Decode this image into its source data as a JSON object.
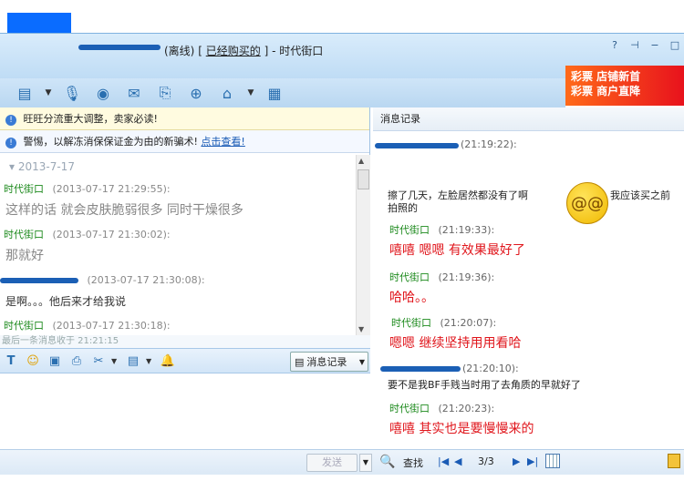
{
  "titlebar": {
    "status": "(离线)",
    "bracket_open": "[",
    "purchase_link": "已经购买的",
    "bracket_close": "]",
    "separator": "-",
    "shop_name": "时代街口"
  },
  "title_buttons": [
    "?",
    "⊣",
    "−",
    "□"
  ],
  "ad": {
    "line1": "彩票  店铺新首",
    "line2": "彩票  商户直降"
  },
  "toolbar_icons": [
    "send-file-icon",
    "microphone-icon",
    "camera-icon",
    "message-icon",
    "mail-icon",
    "share-icon",
    "shop-icon",
    "document-icon"
  ],
  "notices": [
    {
      "text": "旺旺分流重大调整，卖家必读!",
      "link": ""
    },
    {
      "text": "警惕，以解冻消保保证金为由的新骗术!",
      "link": "点击查看!"
    }
  ],
  "history": {
    "date": "2013-7-17",
    "items": [
      {
        "name": "时代街口",
        "time": "(2013-07-17 21:29:55):",
        "msg": "这样的话 就会皮肤脆弱很多 同时干燥很多",
        "small": false
      },
      {
        "name": "时代街口",
        "time": "(2013-07-17 21:30:02):",
        "msg": "那就好",
        "small": false
      },
      {
        "name": "",
        "time": "(2013-07-17 21:30:08):",
        "msg": "是啊。。。他后来才给我说",
        "small": true
      },
      {
        "name": "时代街口",
        "time": "(2013-07-17 21:30:18):",
        "msg": "",
        "small": false
      }
    ],
    "last_received": "最后一条消息收于 21:21:15"
  },
  "input_toolbar": {
    "history_button": "消息记录"
  },
  "record_panel": {
    "header": "消息记录",
    "entries": [
      {
        "name": "",
        "time": "(21:19:22):",
        "msg": "擦了几天，左脸居然都没有了啊",
        "msg2": "我应该买之前",
        "msg3": "拍照的",
        "style": "black"
      },
      {
        "name": "时代街口",
        "time": "(21:19:33):",
        "msg": "嘻嘻 嗯嗯 有效果最好了",
        "style": "red"
      },
      {
        "name": "时代街口",
        "time": "(21:19:36):",
        "msg": "哈哈。。",
        "style": "red"
      },
      {
        "name": "时代街口",
        "time": "(21:20:07):",
        "msg": "嗯嗯 继续坚持用用看哈",
        "style": "red"
      },
      {
        "name": "",
        "time": "(21:20:10):",
        "msg": "要不是我BF手贱当时用了去角质的早就好了",
        "style": "black"
      },
      {
        "name": "时代街口",
        "time": "(21:20:23):",
        "msg": "嘻嘻 其实也是要慢慢来的",
        "style": "red"
      }
    ]
  },
  "bottombar": {
    "send_label": "发送",
    "find_label": "查找",
    "first": "|◀",
    "prev": "◀",
    "page": "3/3",
    "next": "▶",
    "last": "▶|"
  }
}
